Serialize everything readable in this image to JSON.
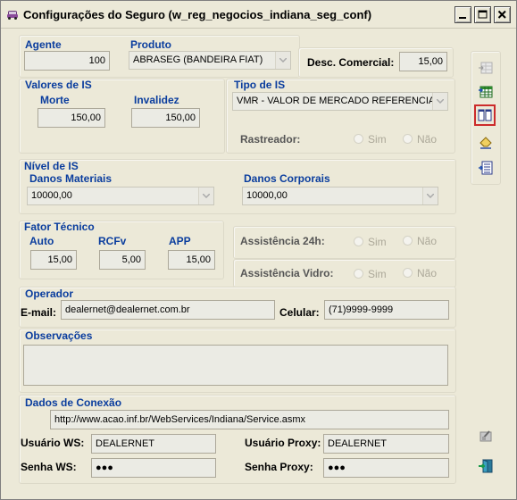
{
  "window": {
    "title": "Configurações do Seguro (w_reg_negocios_indiana_seg_conf)"
  },
  "agente": {
    "label": "Agente",
    "value": "100"
  },
  "produto": {
    "label": "Produto",
    "value": "ABRASEG (BANDEIRA FIAT)"
  },
  "desc_comercial": {
    "label": "Desc. Comercial:",
    "value": "15,00"
  },
  "valores_is": {
    "label": "Valores de IS",
    "morte_label": "Morte",
    "morte_value": "150,00",
    "invalidez_label": "Invalidez",
    "invalidez_value": "150,00"
  },
  "tipo_is": {
    "label": "Tipo de IS",
    "value": "VMR - VALOR DE MERCADO REFERENCIADO"
  },
  "rastreador": {
    "label": "Rastreador:",
    "sim": "Sim",
    "nao": "Não"
  },
  "nivel_is": {
    "label": "Nível de IS",
    "danos_materiais_label": "Danos Materiais",
    "danos_materiais_value": "10000,00",
    "danos_corporais_label": "Danos Corporais",
    "danos_corporais_value": "10000,00"
  },
  "fator_tecnico": {
    "label": "Fator Técnico",
    "auto_label": "Auto",
    "auto_value": "15,00",
    "rcfv_label": "RCFv",
    "rcfv_value": "5,00",
    "app_label": "APP",
    "app_value": "15,00"
  },
  "assistencia_24h": {
    "label": "Assistência 24h:",
    "sim": "Sim",
    "nao": "Não"
  },
  "assistencia_vidro": {
    "label": "Assistência Vidro:",
    "sim": "Sim",
    "nao": "Não"
  },
  "operador": {
    "label": "Operador",
    "email_label": "E-mail:",
    "email_value": "dealernet@dealernet.com.br",
    "celular_label": "Celular:",
    "celular_value": "(71)9999-9999"
  },
  "observacoes": {
    "label": "Observações",
    "value": ""
  },
  "conexao": {
    "label": "Dados de Conexão",
    "url": "http://www.acao.inf.br/WebServices/Indiana/Service.asmx",
    "usuario_ws_label": "Usuário WS:",
    "usuario_ws_value": "DEALERNET",
    "senha_ws_label": "Senha WS:",
    "senha_ws_value": "●●●",
    "usuario_proxy_label": "Usuário Proxy:",
    "usuario_proxy_value": "DEALERNET",
    "senha_proxy_label": "Senha Proxy:",
    "senha_proxy_value": "●●●"
  },
  "toolbar_icons": [
    "insert-row-icon",
    "spreadsheet-icon",
    "columns-icon",
    "eraser-icon",
    "import-list-icon"
  ],
  "colors": {
    "label_blue": "#0a3d9e",
    "selected_border": "#cc2b2b",
    "window_bg": "#ece9d8"
  }
}
